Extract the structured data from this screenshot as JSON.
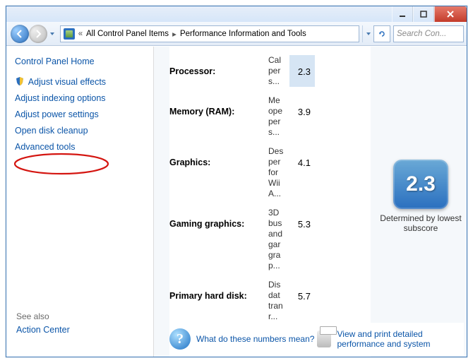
{
  "breadcrumb": {
    "prefix": "«",
    "items": [
      "All Control Panel Items",
      "Performance Information and Tools"
    ]
  },
  "search": {
    "placeholder": "Search Con..."
  },
  "sidebar": {
    "home": "Control Panel Home",
    "links": [
      "Adjust visual effects",
      "Adjust indexing options",
      "Adjust power settings",
      "Open disk cleanup",
      "Advanced tools"
    ],
    "seealso_label": "See also",
    "action_center": "Action Center"
  },
  "scores": {
    "rows": [
      {
        "label": "Processor:",
        "desc": "Cal per s...",
        "score": "2.3"
      },
      {
        "label": "Memory (RAM):",
        "desc": "Me ope per s...",
        "score": "3.9"
      },
      {
        "label": "Graphics:",
        "desc": "Des per for Wii A...",
        "score": "4.1"
      },
      {
        "label": "Gaming graphics:",
        "desc": "3D bus and gar gra p...",
        "score": "5.3"
      },
      {
        "label": "Primary hard disk:",
        "desc": "Dis dat tran r...",
        "score": "5.7"
      }
    ],
    "big_score": "2.3",
    "big_caption": "Determined by lowest subscore"
  },
  "bottom": {
    "link1": "What do these numbers mean?",
    "link2": "View and print detailed performance and system"
  }
}
